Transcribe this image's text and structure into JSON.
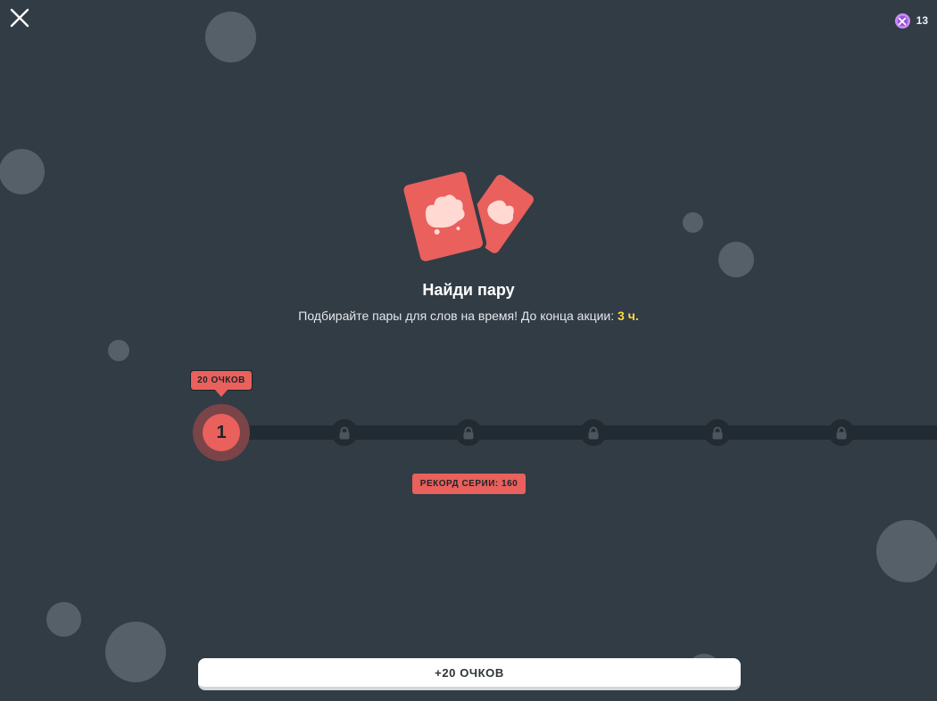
{
  "header": {
    "close_icon": "close-icon",
    "gem_icon": "gem-icon",
    "gem_count": "13"
  },
  "hero": {
    "illustration": "matching-cards-illustration",
    "title": "Найди пару",
    "subtitle_text": "Подбирайте пары для слов на время! До конца акции: ",
    "subtitle_deadline": "3 ч.",
    "deadline_color": "#ffd93a"
  },
  "progress": {
    "active_points_label": "20 ОЧКОВ",
    "active_step": "1",
    "locked_nodes": 5,
    "lock_icon": "lock-icon",
    "record_label": "РЕКОРД СЕРИИ: 160"
  },
  "footer": {
    "claim_button_label": "+20 ОЧКОВ"
  },
  "colors": {
    "background": "#313c45",
    "accent": "#e9605d",
    "track": "#222b32",
    "bubble": "#5d666e"
  }
}
